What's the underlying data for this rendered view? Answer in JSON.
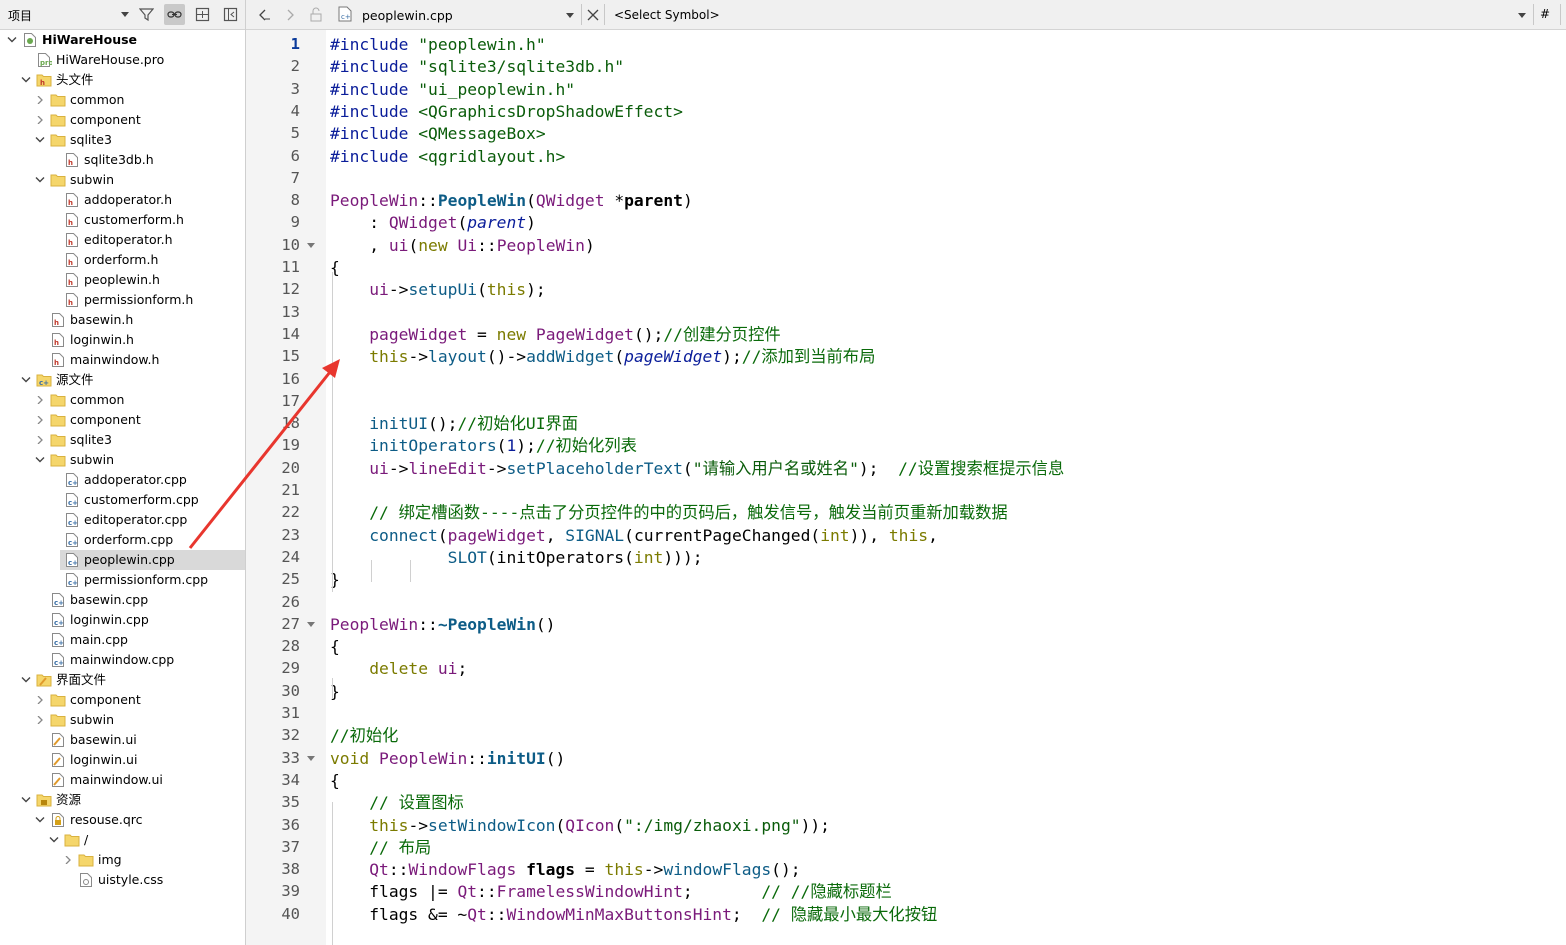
{
  "left_toolbar": {
    "project_select_label": "项目",
    "icons": [
      "filter-icon",
      "link-icon",
      "add-split-icon",
      "split-icon"
    ]
  },
  "tree": [
    {
      "label": "HiWareHouse",
      "level": 0,
      "expanded": true,
      "icon": "project",
      "bold": true
    },
    {
      "label": "HiWareHouse.pro",
      "level": 1,
      "icon": "pro-file"
    },
    {
      "label": "头文件",
      "level": 1,
      "expanded": true,
      "icon": "header-group"
    },
    {
      "label": "common",
      "level": 2,
      "expanded": false,
      "icon": "folder"
    },
    {
      "label": "component",
      "level": 2,
      "expanded": false,
      "icon": "folder"
    },
    {
      "label": "sqlite3",
      "level": 2,
      "expanded": true,
      "icon": "folder"
    },
    {
      "label": "sqlite3db.h",
      "level": 3,
      "icon": "h-file"
    },
    {
      "label": "subwin",
      "level": 2,
      "expanded": true,
      "icon": "folder"
    },
    {
      "label": "addoperator.h",
      "level": 3,
      "icon": "h-file"
    },
    {
      "label": "customerform.h",
      "level": 3,
      "icon": "h-file"
    },
    {
      "label": "editoperator.h",
      "level": 3,
      "icon": "h-file"
    },
    {
      "label": "orderform.h",
      "level": 3,
      "icon": "h-file"
    },
    {
      "label": "peoplewin.h",
      "level": 3,
      "icon": "h-file"
    },
    {
      "label": "permissionform.h",
      "level": 3,
      "icon": "h-file"
    },
    {
      "label": "basewin.h",
      "level": 2,
      "icon": "h-file"
    },
    {
      "label": "loginwin.h",
      "level": 2,
      "icon": "h-file"
    },
    {
      "label": "mainwindow.h",
      "level": 2,
      "icon": "h-file"
    },
    {
      "label": "源文件",
      "level": 1,
      "expanded": true,
      "icon": "source-group"
    },
    {
      "label": "common",
      "level": 2,
      "expanded": false,
      "icon": "folder"
    },
    {
      "label": "component",
      "level": 2,
      "expanded": false,
      "icon": "folder"
    },
    {
      "label": "sqlite3",
      "level": 2,
      "expanded": false,
      "icon": "folder"
    },
    {
      "label": "subwin",
      "level": 2,
      "expanded": true,
      "icon": "folder"
    },
    {
      "label": "addoperator.cpp",
      "level": 3,
      "icon": "cpp-file"
    },
    {
      "label": "customerform.cpp",
      "level": 3,
      "icon": "cpp-file"
    },
    {
      "label": "editoperator.cpp",
      "level": 3,
      "icon": "cpp-file"
    },
    {
      "label": "orderform.cpp",
      "level": 3,
      "icon": "cpp-file"
    },
    {
      "label": "peoplewin.cpp",
      "level": 3,
      "icon": "cpp-file",
      "selected": true
    },
    {
      "label": "permissionform.cpp",
      "level": 3,
      "icon": "cpp-file"
    },
    {
      "label": "basewin.cpp",
      "level": 2,
      "icon": "cpp-file"
    },
    {
      "label": "loginwin.cpp",
      "level": 2,
      "icon": "cpp-file"
    },
    {
      "label": "main.cpp",
      "level": 2,
      "icon": "cpp-file"
    },
    {
      "label": "mainwindow.cpp",
      "level": 2,
      "icon": "cpp-file"
    },
    {
      "label": "界面文件",
      "level": 1,
      "expanded": true,
      "icon": "form-group"
    },
    {
      "label": "component",
      "level": 2,
      "expanded": false,
      "icon": "folder"
    },
    {
      "label": "subwin",
      "level": 2,
      "expanded": false,
      "icon": "folder"
    },
    {
      "label": "basewin.ui",
      "level": 2,
      "icon": "ui-file"
    },
    {
      "label": "loginwin.ui",
      "level": 2,
      "icon": "ui-file"
    },
    {
      "label": "mainwindow.ui",
      "level": 2,
      "icon": "ui-file"
    },
    {
      "label": "资源",
      "level": 1,
      "expanded": true,
      "icon": "resource-group"
    },
    {
      "label": "resouse.qrc",
      "level": 2,
      "expanded": true,
      "icon": "qrc-file"
    },
    {
      "label": "/",
      "level": 3,
      "expanded": true,
      "icon": "folder"
    },
    {
      "label": "img",
      "level": 4,
      "expanded": false,
      "icon": "folder"
    },
    {
      "label": "uistyle.css",
      "level": 4,
      "icon": "css-file"
    }
  ],
  "editor_toolbar": {
    "file_name": "peoplewin.cpp",
    "symbol_placeholder": "<Select Symbol>",
    "hash_label": "#"
  },
  "editor": {
    "current_line": 1,
    "lines": [
      {
        "n": 1,
        "tokens": [
          [
            "pp",
            "#include "
          ],
          [
            "str",
            "\"peoplewin.h\""
          ]
        ]
      },
      {
        "n": 2,
        "tokens": [
          [
            "pp",
            "#include "
          ],
          [
            "str",
            "\"sqlite3/sqlite3db.h\""
          ]
        ]
      },
      {
        "n": 3,
        "tokens": [
          [
            "pp",
            "#include "
          ],
          [
            "str",
            "\"ui_peoplewin.h\""
          ]
        ]
      },
      {
        "n": 4,
        "tokens": [
          [
            "pp",
            "#include "
          ],
          [
            "str",
            "<QGraphicsDropShadowEffect>"
          ]
        ]
      },
      {
        "n": 5,
        "tokens": [
          [
            "pp",
            "#include "
          ],
          [
            "str",
            "<QMessageBox>"
          ]
        ]
      },
      {
        "n": 6,
        "tokens": [
          [
            "pp",
            "#include "
          ],
          [
            "str",
            "<qgridlayout.h>"
          ]
        ]
      },
      {
        "n": 7,
        "tokens": []
      },
      {
        "n": 8,
        "tokens": [
          [
            "cls",
            "PeopleWin"
          ],
          [
            "",
            "::"
          ],
          [
            "fnb",
            "PeopleWin"
          ],
          [
            "",
            "("
          ],
          [
            "ty",
            "QWidget"
          ],
          [
            "",
            " *"
          ],
          [
            "b",
            "parent"
          ],
          [
            "",
            ")"
          ]
        ]
      },
      {
        "n": 9,
        "tokens": [
          [
            "",
            "    : "
          ],
          [
            "ty",
            "QWidget"
          ],
          [
            "",
            "("
          ],
          [
            "par",
            "parent"
          ],
          [
            "",
            ")"
          ]
        ]
      },
      {
        "n": 10,
        "fold": true,
        "tokens": [
          [
            "",
            "    , "
          ],
          [
            "ty",
            "ui"
          ],
          [
            "",
            "("
          ],
          [
            "kw",
            "new"
          ],
          [
            "",
            " "
          ],
          [
            "cls",
            "Ui"
          ],
          [
            "",
            "::"
          ],
          [
            "cls",
            "PeopleWin"
          ],
          [
            "",
            ")"
          ]
        ]
      },
      {
        "n": 11,
        "tokens": [
          [
            "",
            "{"
          ]
        ]
      },
      {
        "n": 12,
        "tokens": [
          [
            "",
            "    "
          ],
          [
            "ty",
            "ui"
          ],
          [
            "",
            "->"
          ],
          [
            "fn",
            "setupUi"
          ],
          [
            "",
            "("
          ],
          [
            "kw",
            "this"
          ],
          [
            "",
            ");"
          ]
        ]
      },
      {
        "n": 13,
        "tokens": []
      },
      {
        "n": 14,
        "tokens": [
          [
            "",
            "    "
          ],
          [
            "ty",
            "pageWidget"
          ],
          [
            "",
            " = "
          ],
          [
            "kw",
            "new"
          ],
          [
            "",
            " "
          ],
          [
            "cls",
            "PageWidget"
          ],
          [
            "",
            "();"
          ],
          [
            "cm",
            "//创建分页控件"
          ]
        ]
      },
      {
        "n": 15,
        "tokens": [
          [
            "",
            "    "
          ],
          [
            "kw",
            "this"
          ],
          [
            "",
            "->"
          ],
          [
            "fn",
            "layout"
          ],
          [
            "",
            "()->"
          ],
          [
            "fn",
            "addWidget"
          ],
          [
            "",
            "("
          ],
          [
            "par",
            "pageWidget"
          ],
          [
            "",
            ");"
          ],
          [
            "cm",
            "//添加到当前布局"
          ]
        ]
      },
      {
        "n": 16,
        "tokens": []
      },
      {
        "n": 17,
        "tokens": []
      },
      {
        "n": 18,
        "tokens": [
          [
            "",
            "    "
          ],
          [
            "fn",
            "initUI"
          ],
          [
            "",
            "();"
          ],
          [
            "cm",
            "//初始化UI界面"
          ]
        ]
      },
      {
        "n": 19,
        "tokens": [
          [
            "",
            "    "
          ],
          [
            "fn",
            "initOperators"
          ],
          [
            "",
            "("
          ],
          [
            "num",
            "1"
          ],
          [
            "",
            ");"
          ],
          [
            "cm",
            "//初始化列表"
          ]
        ]
      },
      {
        "n": 20,
        "tokens": [
          [
            "",
            "    "
          ],
          [
            "ty",
            "ui"
          ],
          [
            "",
            "->"
          ],
          [
            "ty",
            "lineEdit"
          ],
          [
            "",
            "->"
          ],
          [
            "fn",
            "setPlaceholderText"
          ],
          [
            "",
            "("
          ],
          [
            "str",
            "\"请输入用户名或姓名\""
          ],
          [
            "",
            ");  "
          ],
          [
            "cm",
            "//设置搜索框提示信息"
          ]
        ]
      },
      {
        "n": 21,
        "tokens": []
      },
      {
        "n": 22,
        "tokens": [
          [
            "",
            "    "
          ],
          [
            "cm",
            "// 绑定槽函数----点击了分页控件的中的页码后，触发信号，触发当前页重新加载数据"
          ]
        ]
      },
      {
        "n": 23,
        "tokens": [
          [
            "",
            "    "
          ],
          [
            "fn",
            "connect"
          ],
          [
            "",
            "("
          ],
          [
            "ty",
            "pageWidget"
          ],
          [
            "",
            ", "
          ],
          [
            "fn",
            "SIGNAL"
          ],
          [
            "",
            "("
          ],
          [
            "",
            "currentPageChanged"
          ],
          [
            "",
            "("
          ],
          [
            "kw",
            "int"
          ],
          [
            "",
            ")), "
          ],
          [
            "kw",
            "this"
          ],
          [
            "",
            ","
          ]
        ]
      },
      {
        "n": 24,
        "tokens": [
          [
            "",
            "            "
          ],
          [
            "fn",
            "SLOT"
          ],
          [
            "",
            "("
          ],
          [
            "",
            "initOperators"
          ],
          [
            "",
            "("
          ],
          [
            "kw",
            "int"
          ],
          [
            "",
            ")));"
          ]
        ]
      },
      {
        "n": 25,
        "tokens": [
          [
            "",
            "}"
          ]
        ]
      },
      {
        "n": 26,
        "tokens": []
      },
      {
        "n": 27,
        "fold": true,
        "tokens": [
          [
            "cls",
            "PeopleWin"
          ],
          [
            "",
            "::"
          ],
          [
            "fnb",
            "~PeopleWin"
          ],
          [
            "",
            "()"
          ]
        ]
      },
      {
        "n": 28,
        "tokens": [
          [
            "",
            "{"
          ]
        ]
      },
      {
        "n": 29,
        "tokens": [
          [
            "",
            "    "
          ],
          [
            "kw",
            "delete"
          ],
          [
            "",
            " "
          ],
          [
            "ty",
            "ui"
          ],
          [
            "",
            ";"
          ]
        ]
      },
      {
        "n": 30,
        "tokens": [
          [
            "",
            "}"
          ]
        ]
      },
      {
        "n": 31,
        "tokens": []
      },
      {
        "n": 32,
        "tokens": [
          [
            "cm",
            "//初始化"
          ]
        ]
      },
      {
        "n": 33,
        "fold": true,
        "tokens": [
          [
            "kw",
            "void"
          ],
          [
            "",
            " "
          ],
          [
            "cls",
            "PeopleWin"
          ],
          [
            "",
            "::"
          ],
          [
            "fnb",
            "initUI"
          ],
          [
            "",
            "()"
          ]
        ]
      },
      {
        "n": 34,
        "tokens": [
          [
            "",
            "{"
          ]
        ]
      },
      {
        "n": 35,
        "tokens": [
          [
            "",
            "    "
          ],
          [
            "cm",
            "// 设置图标"
          ]
        ]
      },
      {
        "n": 36,
        "tokens": [
          [
            "",
            "    "
          ],
          [
            "kw",
            "this"
          ],
          [
            "",
            "->"
          ],
          [
            "fn",
            "setWindowIcon"
          ],
          [
            "",
            "("
          ],
          [
            "cls",
            "QIcon"
          ],
          [
            "",
            "("
          ],
          [
            "str",
            "\":/img/zhaoxi.png\""
          ],
          [
            "",
            "));"
          ]
        ]
      },
      {
        "n": 37,
        "tokens": [
          [
            "",
            "    "
          ],
          [
            "cm",
            "// 布局"
          ]
        ]
      },
      {
        "n": 38,
        "tokens": [
          [
            "",
            "    "
          ],
          [
            "cls",
            "Qt"
          ],
          [
            "",
            "::"
          ],
          [
            "cls",
            "WindowFlags"
          ],
          [
            "",
            " "
          ],
          [
            "b",
            "flags"
          ],
          [
            "",
            " = "
          ],
          [
            "kw",
            "this"
          ],
          [
            "",
            "->"
          ],
          [
            "fn",
            "windowFlags"
          ],
          [
            "",
            "();"
          ]
        ]
      },
      {
        "n": 39,
        "tokens": [
          [
            "",
            "    flags |= "
          ],
          [
            "cls",
            "Qt"
          ],
          [
            "",
            "::"
          ],
          [
            "cls",
            "FramelessWindowHint"
          ],
          [
            "",
            ";       "
          ],
          [
            "cm",
            "// //隐藏标题栏"
          ]
        ]
      },
      {
        "n": 40,
        "tokens": [
          [
            "",
            "    flags &= ~"
          ],
          [
            "cls",
            "Qt"
          ],
          [
            "",
            "::"
          ],
          [
            "cls",
            "WindowMinMaxButtonsHint"
          ],
          [
            "",
            ";  "
          ],
          [
            "cm",
            "// 隐藏最小最大化按钮"
          ]
        ]
      }
    ]
  }
}
